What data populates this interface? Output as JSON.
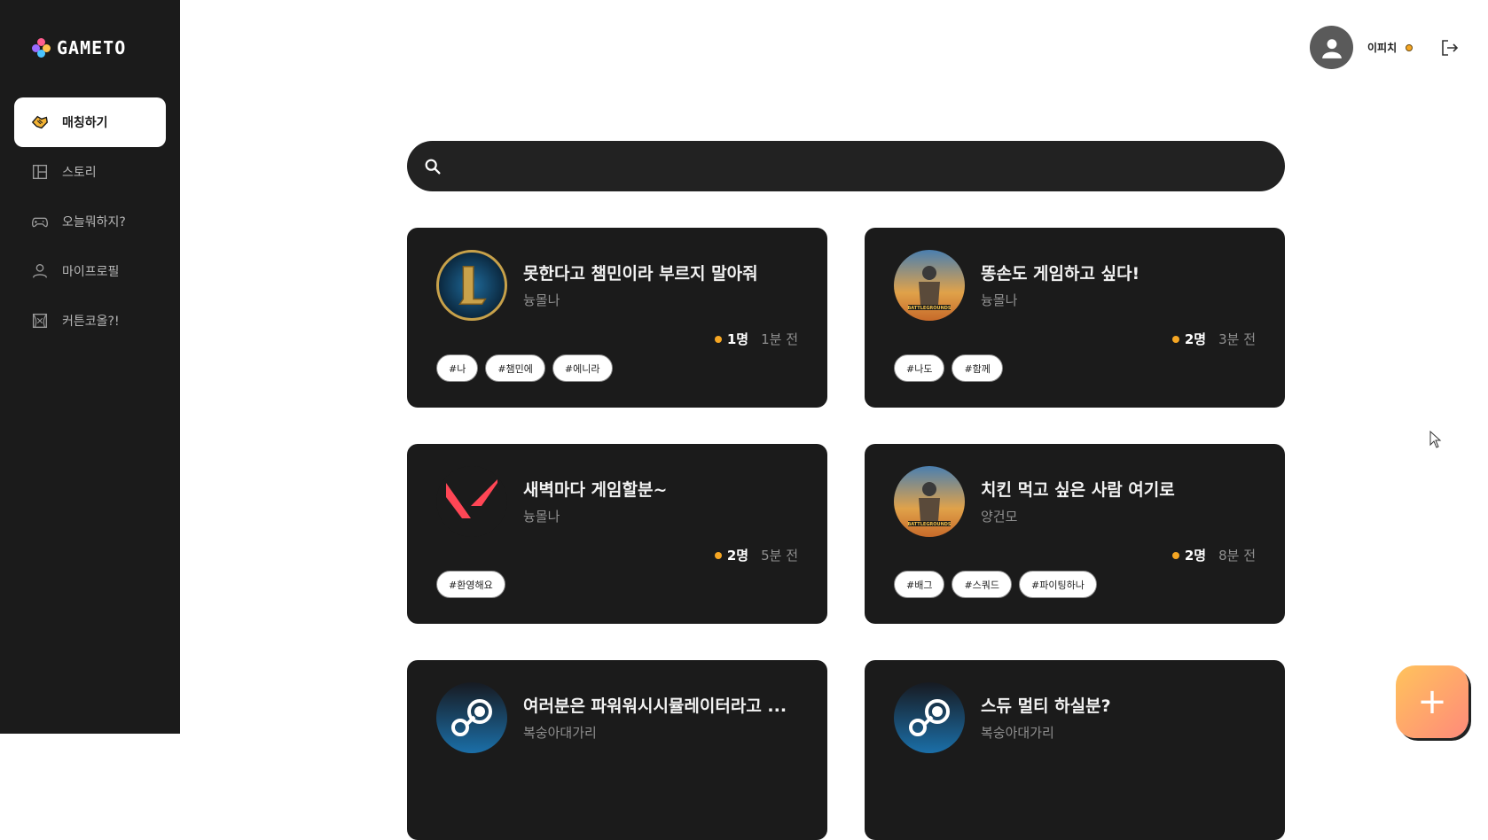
{
  "app": {
    "logo_text": "GAMETO"
  },
  "sidebar": {
    "items": [
      {
        "label": "매칭하기",
        "icon": "handshake-icon",
        "active": true
      },
      {
        "label": "스토리",
        "icon": "layout-icon",
        "active": false
      },
      {
        "label": "오늘뭐하지?",
        "icon": "gamepad-icon",
        "active": false
      },
      {
        "label": "마이프로필",
        "icon": "user-icon",
        "active": false
      },
      {
        "label": "커튼코올?!",
        "icon": "curtain-icon",
        "active": false
      }
    ]
  },
  "header": {
    "username": "이피치",
    "logout_icon": "logout-icon"
  },
  "search": {
    "placeholder": "",
    "value": ""
  },
  "cards": [
    {
      "title": "못한다고 챔민이라 부르지 말아줘",
      "author": "늉몰나",
      "count": "1명",
      "time": "1분 전",
      "game": "lol",
      "tags": [
        "#나",
        "#챔민에",
        "#에니라"
      ]
    },
    {
      "title": "똥손도 게임하고 싶다!",
      "author": "늉몰나",
      "count": "2명",
      "time": "3분 전",
      "game": "pubg",
      "tags": [
        "#나도",
        "#함께"
      ]
    },
    {
      "title": "새벽마다 게임할분~",
      "author": "늉몰나",
      "count": "2명",
      "time": "5분 전",
      "game": "valorant",
      "tags": [
        "#환영해요"
      ]
    },
    {
      "title": "치킨 먹고 싶은 사람 여기로",
      "author": "양건모",
      "count": "2명",
      "time": "8분 전",
      "game": "pubg",
      "tags": [
        "#배그",
        "#스쿼드",
        "#파이팅하나"
      ]
    },
    {
      "title": "여러분은 파워워시시뮬레이터라고 ...",
      "author": "복숭아대가리",
      "count": "",
      "time": "",
      "game": "steam",
      "tags": []
    },
    {
      "title": "스듀 멀티 하실분?",
      "author": "복숭아대가리",
      "count": "",
      "time": "",
      "game": "steam",
      "tags": []
    }
  ],
  "fab": {
    "label": "+"
  }
}
